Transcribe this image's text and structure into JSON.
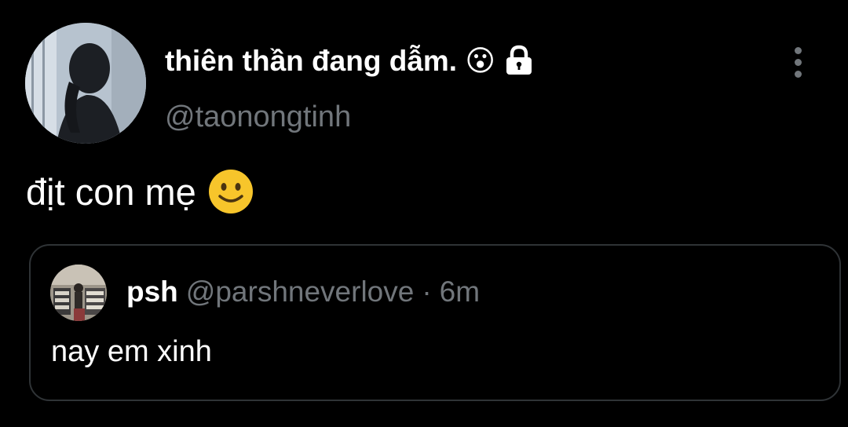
{
  "tweet": {
    "author": {
      "display_name": "thiên thần đang dẫm. 😮",
      "handle": "@taonongtinh",
      "avatar": "silhouette-avatar",
      "protected_icon": "lock-icon"
    },
    "text": "địt con mẹ",
    "emoji": "slightly-smiling-face-emoji",
    "more_icon": "more-vertical-icon"
  },
  "quote": {
    "author": {
      "display_name": "psh",
      "handle": "@parshneverlove",
      "separator": "·",
      "time": "6m",
      "avatar": "room-photo-avatar"
    },
    "text": "nay em xinh"
  },
  "colors": {
    "background": "#000000",
    "primary_text": "#ffffff",
    "secondary_text": "#71767b",
    "border": "#2f3336",
    "emoji": "#f7c52b"
  }
}
